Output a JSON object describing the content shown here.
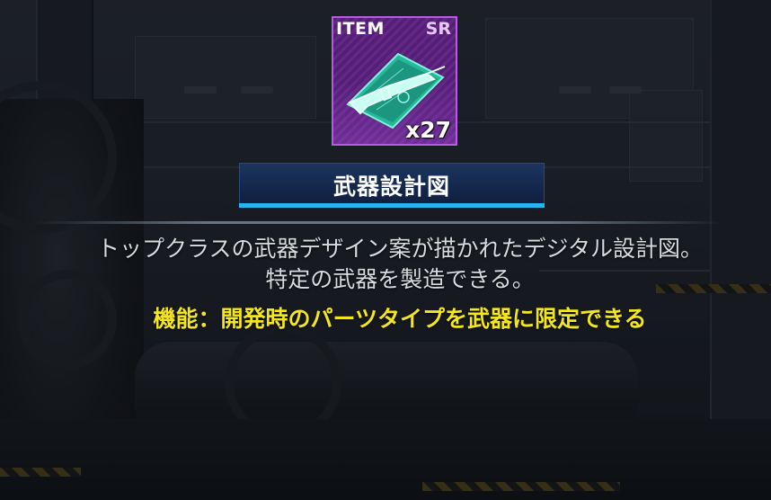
{
  "item": {
    "tag": "ITEM",
    "rarity": "SR",
    "quantity": "x27",
    "icon": "weapon-blueprint-icon",
    "name": "武器設計図"
  },
  "description": "トップクラスの武器デザイン案が描かれたデジタル設計図。特定の武器を製造できる。",
  "feature": "機能：開発時のパーツタイプを武器に限定できる",
  "colors": {
    "card_bg": "#5a1f7e",
    "card_border": "#b35de0",
    "name_underline": "#27b5f2",
    "feature_text": "#f3e61d"
  }
}
